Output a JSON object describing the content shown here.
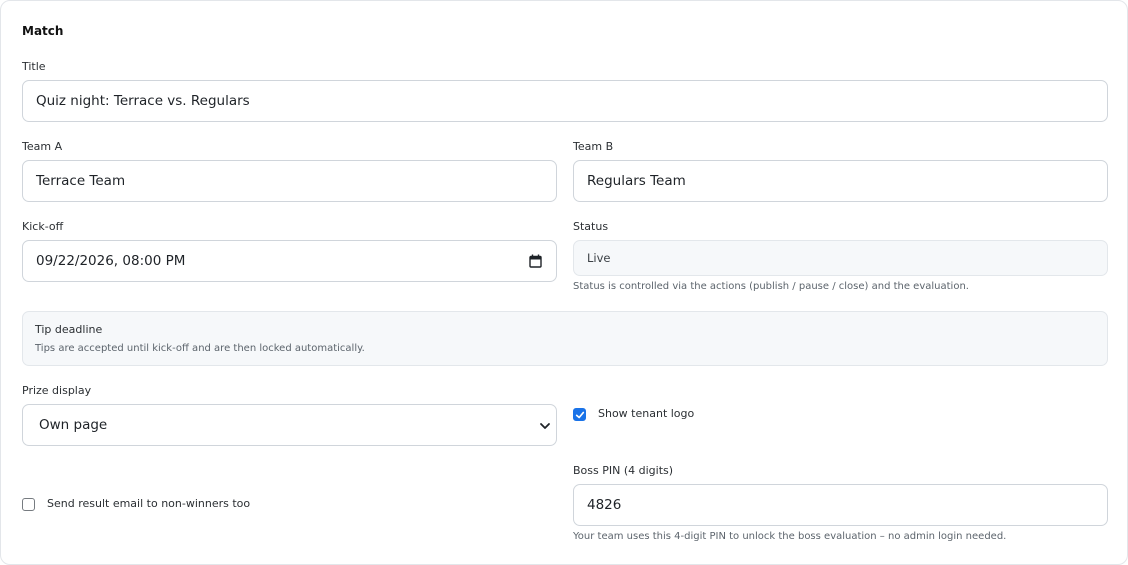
{
  "section": {
    "title": "Match"
  },
  "title_field": {
    "label": "Title",
    "value": "Quiz night: Terrace vs. Regulars"
  },
  "team_a": {
    "label": "Team A",
    "value": "Terrace Team"
  },
  "team_b": {
    "label": "Team B",
    "value": "Regulars Team"
  },
  "kickoff": {
    "label": "Kick-off",
    "value": "09/22/2026, 08:00 PM",
    "icon": "calendar-icon"
  },
  "status": {
    "label": "Status",
    "value": "Live",
    "help": "Status is controlled via the actions (publish / pause / close) and the evaluation."
  },
  "tip_deadline": {
    "title": "Tip deadline",
    "text": "Tips are accepted until kick-off and are then locked automatically."
  },
  "prize_display": {
    "label": "Prize display",
    "value": "Own page",
    "icon": "chevron-down-icon"
  },
  "show_tenant_logo": {
    "label": "Show tenant logo",
    "checked": true
  },
  "send_result_email": {
    "label": "Send result email to non-winners too",
    "checked": false
  },
  "boss_pin": {
    "label": "Boss PIN (4 digits)",
    "value": "4826",
    "help": "Your team uses this 4-digit PIN to unlock the boss evaluation – no admin login needed."
  },
  "colors": {
    "accent": "#1a73e8",
    "border": "#d0d5db",
    "muted_bg": "#f6f8fa"
  }
}
